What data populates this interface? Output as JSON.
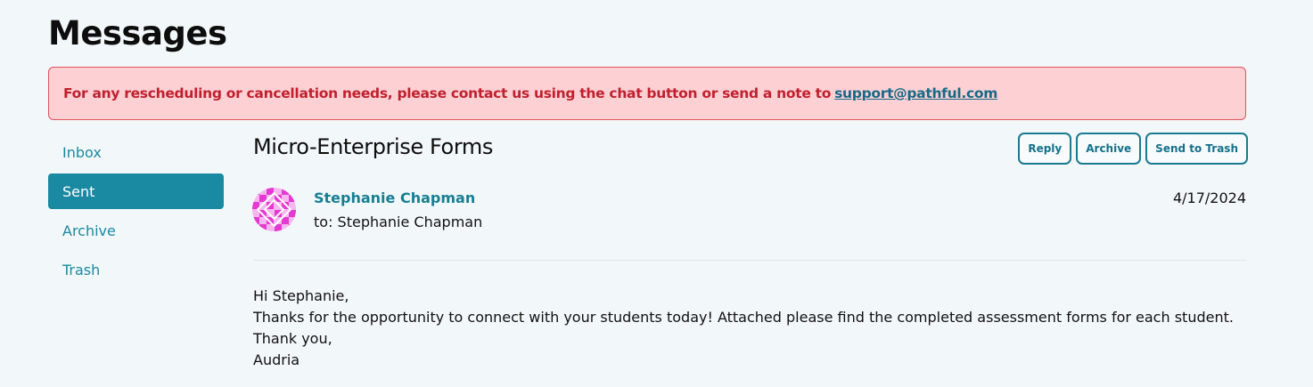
{
  "page": {
    "title": "Messages"
  },
  "alert": {
    "text": "For any rescheduling or cancellation needs, please contact us using the chat button or send a note to",
    "link": "support@pathful.com"
  },
  "sidebar": {
    "items": [
      {
        "label": "Inbox",
        "active": false
      },
      {
        "label": "Sent",
        "active": true
      },
      {
        "label": "Archive",
        "active": false
      },
      {
        "label": "Trash",
        "active": false
      }
    ]
  },
  "message": {
    "subject": "Micro-Enterprise Forms",
    "actions": {
      "reply": "Reply",
      "archive": "Archive",
      "trash": "Send to Trash"
    },
    "sender": "Stephanie Chapman",
    "recipient": "to: Stephanie Chapman",
    "date": "4/17/2024",
    "avatar_icon": "pink-geometric-avatar",
    "body": [
      "Hi Stephanie,",
      "Thanks for the opportunity to connect with your students today! Attached please find the completed assessment forms for each student.",
      "Thank you,",
      "Audria"
    ]
  },
  "colors": {
    "accent": "#1a8aa3",
    "alert_bg": "#fdd0d4",
    "alert_text": "#c0202e",
    "link": "#156a86",
    "avatar": "#e83fd6"
  }
}
